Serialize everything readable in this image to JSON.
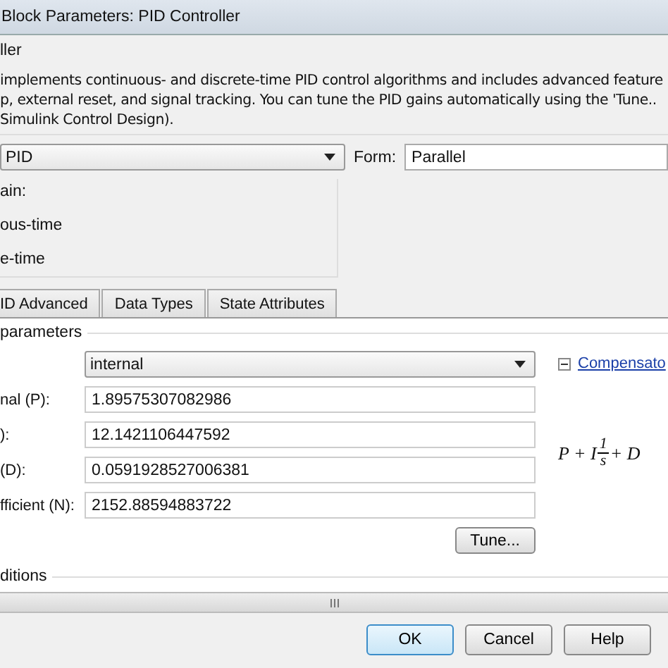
{
  "window": {
    "title": "Block Parameters: PID Controller"
  },
  "block": {
    "name": "ller",
    "description": [
      "implements continuous- and discrete-time PID control algorithms and includes advanced feature",
      "p, external reset, and signal tracking. You can tune the PID gains automatically using the 'Tune..",
      "Simulink Control Design)."
    ]
  },
  "controller": {
    "value": "PID"
  },
  "form": {
    "label": "Form:",
    "value": "Parallel"
  },
  "domain": {
    "label": "ain:",
    "options": [
      "ous-time",
      "e-time"
    ]
  },
  "tabs": [
    {
      "label": "ID Advanced",
      "selected": false
    },
    {
      "label": "Data Types",
      "selected": false
    },
    {
      "label": "State Attributes",
      "selected": false
    }
  ],
  "parameters": {
    "title": "parameters",
    "source": {
      "value": "internal"
    },
    "link": {
      "label": "Compensato",
      "expanded": true
    },
    "fields": [
      {
        "label": "nal (P):",
        "value": "1.89575307082986"
      },
      {
        "label": "):",
        "value": "12.1421106447592"
      },
      {
        "label": "(D):",
        "value": "0.0591928527006381"
      },
      {
        "label": "fficient (N):",
        "value": "2152.88594883722"
      }
    ],
    "tune_button": "Tune...",
    "formula": {
      "lead": "P + I",
      "numerator": "1",
      "denominator": "s",
      "tail": "+ D"
    }
  },
  "next_section": {
    "title": "ditions"
  },
  "buttons": [
    {
      "label": "OK",
      "focused": true
    },
    {
      "label": "Cancel",
      "focused": false
    },
    {
      "label": "Help",
      "focused": false
    }
  ]
}
